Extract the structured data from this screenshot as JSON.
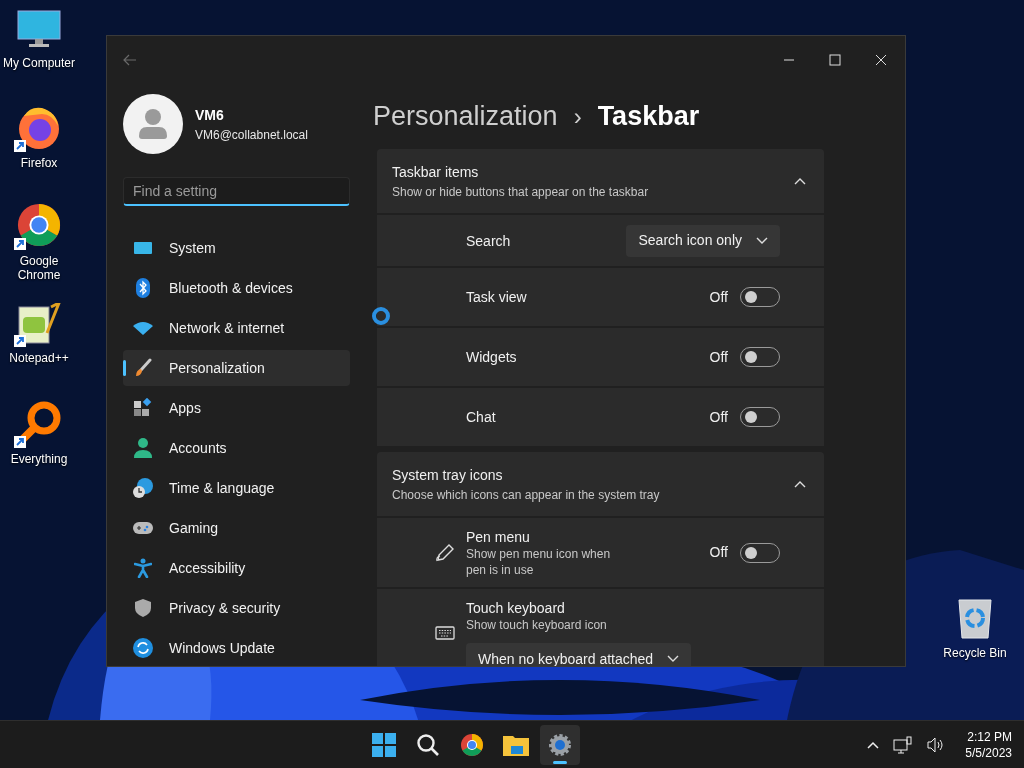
{
  "desktop_icons": [
    {
      "kind": "computer",
      "label": "My Computer",
      "shortcut": false
    },
    {
      "kind": "firefox",
      "label": "Firefox",
      "shortcut": true
    },
    {
      "kind": "chrome",
      "label": "Google Chrome",
      "shortcut": true
    },
    {
      "kind": "notepad",
      "label": "Notepad++",
      "shortcut": true
    },
    {
      "kind": "everything",
      "label": "Everything",
      "shortcut": true
    },
    {
      "kind": "recycle",
      "label": "Recycle Bin",
      "shortcut": false
    }
  ],
  "window": {
    "profile": {
      "name": "VM6",
      "email": "VM6@collabnet.local"
    },
    "search": {
      "placeholder": "Find a setting"
    },
    "nav": [
      {
        "kind": "system",
        "label": "System",
        "selected": false
      },
      {
        "kind": "bluetooth",
        "label": "Bluetooth & devices",
        "selected": false
      },
      {
        "kind": "network",
        "label": "Network & internet",
        "selected": false
      },
      {
        "kind": "personalization",
        "label": "Personalization",
        "selected": true
      },
      {
        "kind": "apps",
        "label": "Apps",
        "selected": false
      },
      {
        "kind": "accounts",
        "label": "Accounts",
        "selected": false
      },
      {
        "kind": "time",
        "label": "Time & language",
        "selected": false
      },
      {
        "kind": "gaming",
        "label": "Gaming",
        "selected": false
      },
      {
        "kind": "accessibility",
        "label": "Accessibility",
        "selected": false
      },
      {
        "kind": "privacy",
        "label": "Privacy & security",
        "selected": false
      },
      {
        "kind": "update",
        "label": "Windows Update",
        "selected": false
      }
    ],
    "breadcrumb": {
      "parent": "Personalization",
      "separator": "›",
      "current": "Taskbar"
    },
    "sections": [
      {
        "title": "Taskbar items",
        "subtitle": "Show or hide buttons that appear on the taskbar",
        "expanded": true,
        "rows": [
          {
            "kind": "dropdown",
            "label": "Search",
            "value": "Search icon only"
          },
          {
            "kind": "toggle",
            "label": "Task view",
            "on": false,
            "state": "Off"
          },
          {
            "kind": "toggle",
            "label": "Widgets",
            "on": false,
            "state": "Off"
          },
          {
            "kind": "toggle",
            "label": "Chat",
            "on": false,
            "state": "Off"
          }
        ]
      },
      {
        "title": "System tray icons",
        "subtitle": "Choose which icons can appear in the system tray",
        "expanded": true,
        "rows": [
          {
            "kind": "toggle",
            "label": "Pen menu",
            "description": "Show pen menu icon when pen is in use",
            "on": false,
            "state": "Off"
          },
          {
            "kind": "dropdown-below",
            "label": "Touch keyboard",
            "description": "Show touch keyboard icon",
            "value": "When no keyboard attached"
          }
        ]
      }
    ]
  },
  "taskbar": {
    "apps": [
      {
        "kind": "start",
        "active": false
      },
      {
        "kind": "search",
        "active": false
      },
      {
        "kind": "chrome",
        "active": false
      },
      {
        "kind": "explorer",
        "active": false
      },
      {
        "kind": "settings",
        "active": true
      }
    ],
    "clock": {
      "time": "2:12 PM",
      "date": "5/5/2023"
    }
  }
}
